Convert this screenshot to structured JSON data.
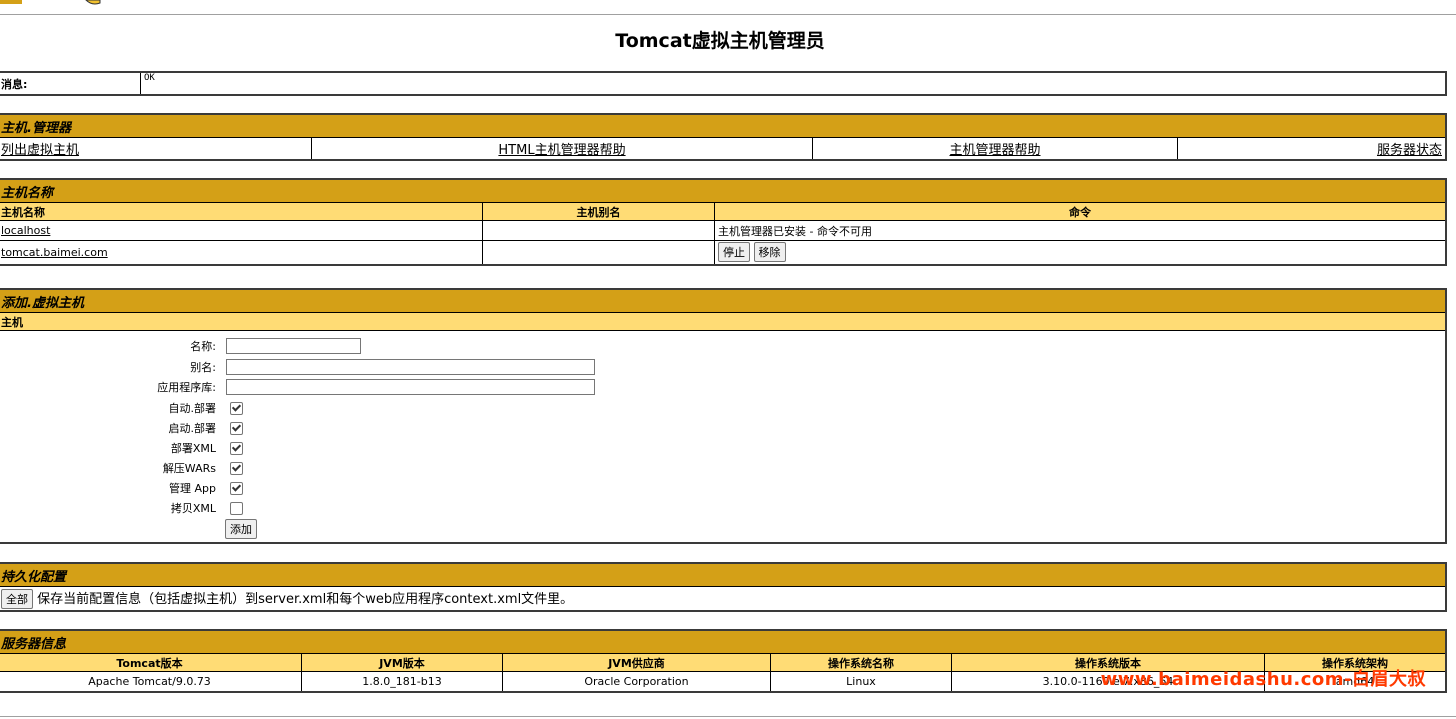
{
  "page_title": "Tomcat虚拟主机管理员",
  "message": {
    "label": "消息:",
    "value": "OK"
  },
  "host_manager": {
    "title": "主机.管理器",
    "links": [
      "列出虚拟主机",
      "HTML主机管理器帮助",
      "主机管理器帮助",
      "服务器状态"
    ]
  },
  "host_name": {
    "title": "主机名称",
    "headers": [
      "主机名称",
      "主机别名",
      "命令"
    ],
    "rows": [
      {
        "name": "localhost",
        "alias": "",
        "command": "主机管理器已安装 - 命令不可用"
      },
      {
        "name": "tomcat.baimei.com",
        "alias": "",
        "stop": "停止",
        "remove": "移除"
      }
    ]
  },
  "add_host": {
    "title": "添加.虚拟主机",
    "subtitle": "主机",
    "labels": {
      "name": "名称:",
      "aliases": "别名:",
      "app_base": "应用程序库:",
      "auto_deploy": "自动.部署",
      "deploy_on_startup": "启动.部署",
      "deploy_xml": "部署XML",
      "unpack_wars": "解压WARs",
      "manager_app": "管理 App",
      "copy_xml": "拷贝XML"
    },
    "checks": {
      "auto_deploy": true,
      "deploy_on_startup": true,
      "deploy_xml": true,
      "unpack_wars": true,
      "manager_app": true,
      "copy_xml": false
    },
    "add_button": "添加"
  },
  "persist": {
    "title": "持久化配置",
    "button": "全部",
    "description": "保存当前配置信息（包括虚拟主机）到server.xml和每个web应用程序context.xml文件里。"
  },
  "server_info": {
    "title": "服务器信息",
    "headers": [
      "Tomcat版本",
      "JVM版本",
      "JVM供应商",
      "操作系统名称",
      "操作系统版本",
      "操作系统架构"
    ],
    "values": [
      "Apache Tomcat/9.0.73",
      "1.8.0_181-b13",
      "Oracle Corporation",
      "Linux",
      "3.10.0-1160.el7.x86_64",
      "amd64"
    ]
  },
  "watermark": "www.baimeidashu.com-白眉大叔"
}
